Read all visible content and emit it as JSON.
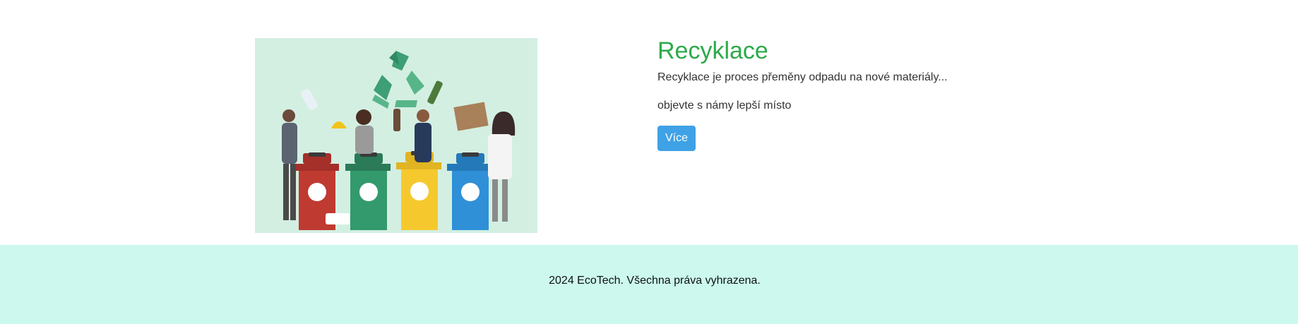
{
  "article": {
    "title": "Recyklace",
    "description": "Recyklace je proces přeměny odpadu na nové materiály...",
    "tagline": "objevte s námy lepší místo",
    "button_label": "Více"
  },
  "footer": {
    "text": "2024 EcoTech. Všechna práva vyhrazena."
  },
  "colors": {
    "title": "#2eaa4a",
    "button": "#3fa2e6",
    "footer_bg": "#ccf8ee",
    "image_bg": "#d3efe2"
  },
  "icons": [
    "recycle-icon"
  ]
}
